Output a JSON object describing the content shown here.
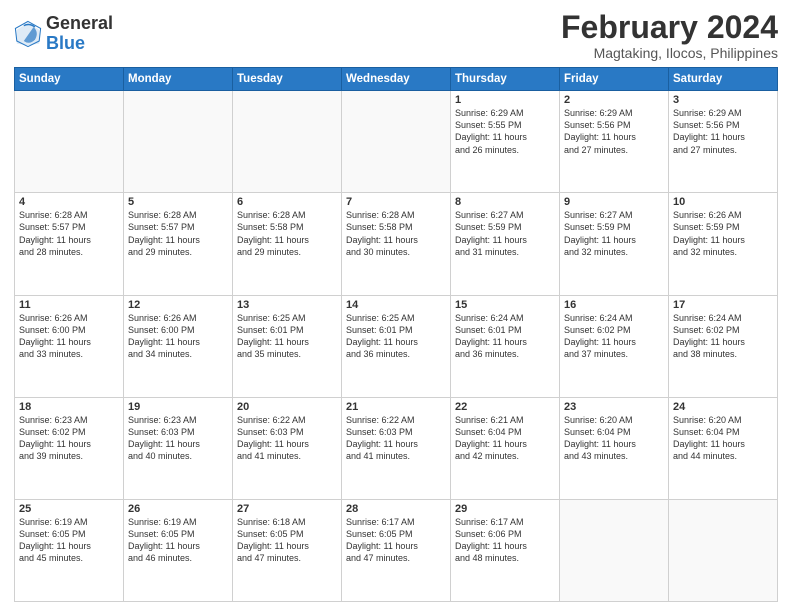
{
  "header": {
    "logo_general": "General",
    "logo_blue": "Blue",
    "main_title": "February 2024",
    "subtitle": "Magtaking, Ilocos, Philippines"
  },
  "days_of_week": [
    "Sunday",
    "Monday",
    "Tuesday",
    "Wednesday",
    "Thursday",
    "Friday",
    "Saturday"
  ],
  "weeks": [
    [
      {
        "day": "",
        "info": ""
      },
      {
        "day": "",
        "info": ""
      },
      {
        "day": "",
        "info": ""
      },
      {
        "day": "",
        "info": ""
      },
      {
        "day": "1",
        "info": "Sunrise: 6:29 AM\nSunset: 5:55 PM\nDaylight: 11 hours\nand 26 minutes."
      },
      {
        "day": "2",
        "info": "Sunrise: 6:29 AM\nSunset: 5:56 PM\nDaylight: 11 hours\nand 27 minutes."
      },
      {
        "day": "3",
        "info": "Sunrise: 6:29 AM\nSunset: 5:56 PM\nDaylight: 11 hours\nand 27 minutes."
      }
    ],
    [
      {
        "day": "4",
        "info": "Sunrise: 6:28 AM\nSunset: 5:57 PM\nDaylight: 11 hours\nand 28 minutes."
      },
      {
        "day": "5",
        "info": "Sunrise: 6:28 AM\nSunset: 5:57 PM\nDaylight: 11 hours\nand 29 minutes."
      },
      {
        "day": "6",
        "info": "Sunrise: 6:28 AM\nSunset: 5:58 PM\nDaylight: 11 hours\nand 29 minutes."
      },
      {
        "day": "7",
        "info": "Sunrise: 6:28 AM\nSunset: 5:58 PM\nDaylight: 11 hours\nand 30 minutes."
      },
      {
        "day": "8",
        "info": "Sunrise: 6:27 AM\nSunset: 5:59 PM\nDaylight: 11 hours\nand 31 minutes."
      },
      {
        "day": "9",
        "info": "Sunrise: 6:27 AM\nSunset: 5:59 PM\nDaylight: 11 hours\nand 32 minutes."
      },
      {
        "day": "10",
        "info": "Sunrise: 6:26 AM\nSunset: 5:59 PM\nDaylight: 11 hours\nand 32 minutes."
      }
    ],
    [
      {
        "day": "11",
        "info": "Sunrise: 6:26 AM\nSunset: 6:00 PM\nDaylight: 11 hours\nand 33 minutes."
      },
      {
        "day": "12",
        "info": "Sunrise: 6:26 AM\nSunset: 6:00 PM\nDaylight: 11 hours\nand 34 minutes."
      },
      {
        "day": "13",
        "info": "Sunrise: 6:25 AM\nSunset: 6:01 PM\nDaylight: 11 hours\nand 35 minutes."
      },
      {
        "day": "14",
        "info": "Sunrise: 6:25 AM\nSunset: 6:01 PM\nDaylight: 11 hours\nand 36 minutes."
      },
      {
        "day": "15",
        "info": "Sunrise: 6:24 AM\nSunset: 6:01 PM\nDaylight: 11 hours\nand 36 minutes."
      },
      {
        "day": "16",
        "info": "Sunrise: 6:24 AM\nSunset: 6:02 PM\nDaylight: 11 hours\nand 37 minutes."
      },
      {
        "day": "17",
        "info": "Sunrise: 6:24 AM\nSunset: 6:02 PM\nDaylight: 11 hours\nand 38 minutes."
      }
    ],
    [
      {
        "day": "18",
        "info": "Sunrise: 6:23 AM\nSunset: 6:02 PM\nDaylight: 11 hours\nand 39 minutes."
      },
      {
        "day": "19",
        "info": "Sunrise: 6:23 AM\nSunset: 6:03 PM\nDaylight: 11 hours\nand 40 minutes."
      },
      {
        "day": "20",
        "info": "Sunrise: 6:22 AM\nSunset: 6:03 PM\nDaylight: 11 hours\nand 41 minutes."
      },
      {
        "day": "21",
        "info": "Sunrise: 6:22 AM\nSunset: 6:03 PM\nDaylight: 11 hours\nand 41 minutes."
      },
      {
        "day": "22",
        "info": "Sunrise: 6:21 AM\nSunset: 6:04 PM\nDaylight: 11 hours\nand 42 minutes."
      },
      {
        "day": "23",
        "info": "Sunrise: 6:20 AM\nSunset: 6:04 PM\nDaylight: 11 hours\nand 43 minutes."
      },
      {
        "day": "24",
        "info": "Sunrise: 6:20 AM\nSunset: 6:04 PM\nDaylight: 11 hours\nand 44 minutes."
      }
    ],
    [
      {
        "day": "25",
        "info": "Sunrise: 6:19 AM\nSunset: 6:05 PM\nDaylight: 11 hours\nand 45 minutes."
      },
      {
        "day": "26",
        "info": "Sunrise: 6:19 AM\nSunset: 6:05 PM\nDaylight: 11 hours\nand 46 minutes."
      },
      {
        "day": "27",
        "info": "Sunrise: 6:18 AM\nSunset: 6:05 PM\nDaylight: 11 hours\nand 47 minutes."
      },
      {
        "day": "28",
        "info": "Sunrise: 6:17 AM\nSunset: 6:05 PM\nDaylight: 11 hours\nand 47 minutes."
      },
      {
        "day": "29",
        "info": "Sunrise: 6:17 AM\nSunset: 6:06 PM\nDaylight: 11 hours\nand 48 minutes."
      },
      {
        "day": "",
        "info": ""
      },
      {
        "day": "",
        "info": ""
      }
    ]
  ]
}
